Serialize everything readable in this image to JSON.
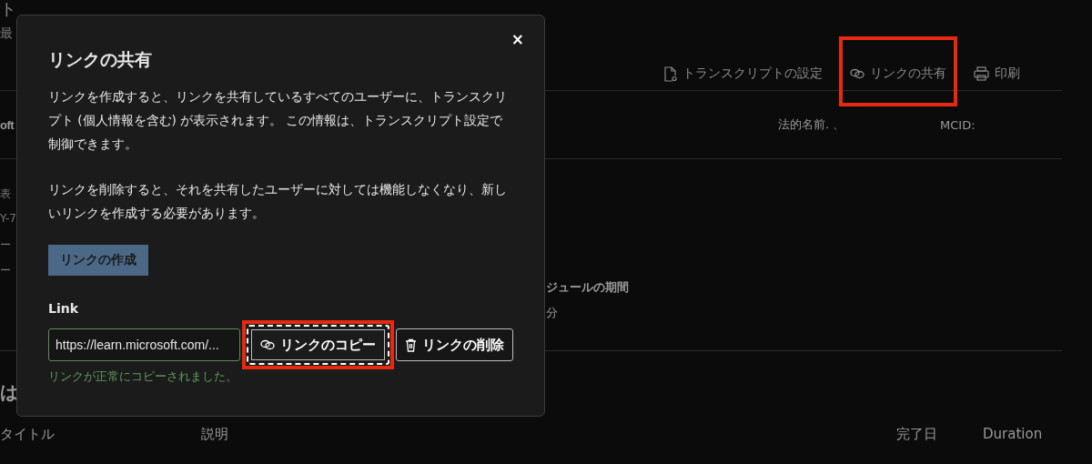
{
  "page": {
    "title_fragment": "ト",
    "subtitle_fragment": "最",
    "toolbar": [
      {
        "kind": "settings",
        "label": "トランスクリプトの設定",
        "highlighted": false
      },
      {
        "kind": "share",
        "label": "リンクの共有",
        "highlighted": true
      },
      {
        "kind": "print",
        "label": "印刷",
        "highlighted": false
      }
    ],
    "profile": {
      "name_fragment": "oft",
      "legal_name_label": "法的名前. 、",
      "mcid_label": "MCID:"
    },
    "left_fragments": [
      "表",
      "Y-7",
      "ー",
      "ー"
    ],
    "schedule_duration": {
      "label": "ジュールの期間",
      "value": "分"
    },
    "section_fragment": "は",
    "table": {
      "columns": [
        "タイトル",
        "説明",
        "完了日",
        "Duration"
      ]
    }
  },
  "dialog": {
    "close": "×",
    "title": "リンクの共有",
    "paragraphs": [
      "リンクを作成すると、リンクを共有しているすべてのユーザーに、トランスクリプト (個人情報を含む) が表示されます。 この情報は、トランスクリプト設定で制御できます。",
      "リンクを削除すると、それを共有したユーザーに対しては機能しなくなり、新しいリンクを作成する必要があります。"
    ],
    "create_button": "リンクの作成",
    "link_label": "Link",
    "link_value": "https://learn.microsoft.com/...",
    "copy_button": {
      "label": "リンクのコピー",
      "focused": true,
      "highlighted": true
    },
    "delete_button": {
      "label": "リンクの削除"
    },
    "success_message": "リンクが正常にコピーされました。"
  }
}
